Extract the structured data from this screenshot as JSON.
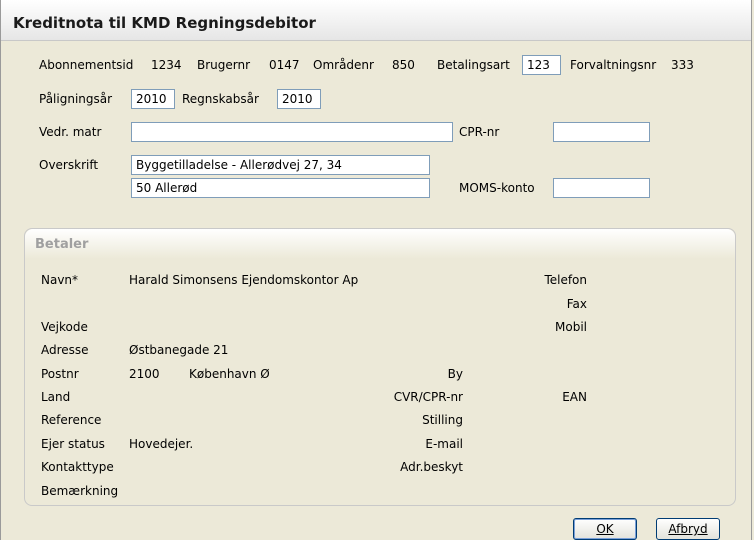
{
  "window": {
    "title": "Kreditnota til KMD Regningsdebitor"
  },
  "header": {
    "abonnementsid_label": "Abonnementsid",
    "abonnementsid_value": "1234",
    "brugernr_label": "Brugernr",
    "brugernr_value": "0147",
    "omraadenr_label": "Områdenr",
    "omraadenr_value": "850",
    "betalingsart_label": "Betalingsart",
    "betalingsart_value": "123",
    "forvaltningsnr_label": "Forvaltningsnr",
    "forvaltningsnr_value": "333",
    "paaligningsaar_label": "Påligningsår",
    "paaligningsaar_value": "2010",
    "regnskabsaar_label": "Regnskabsår",
    "regnskabsaar_value": "2010",
    "vedr_matr_label": "Vedr. matr",
    "vedr_matr_value": "",
    "cpr_label": "CPR-nr",
    "cpr_value": "",
    "overskrift_label": "Overskrift",
    "overskrift_line1": "Byggetilladelse - Allerødvej 27, 34",
    "overskrift_line2": "50  Allerød",
    "moms_label": "MOMS-konto",
    "moms_value": ""
  },
  "betaler": {
    "title": "Betaler",
    "navn_label": "Navn*",
    "navn_value": "Harald Simonsens Ejendomskontor Ap",
    "vejkode_label": "Vejkode",
    "adresse_label": "Adresse",
    "adresse_value": "Østbanegade 21",
    "postnr_label": "Postnr",
    "postnr_value": "2100",
    "city_value": "København Ø",
    "land_label": "Land",
    "reference_label": "Reference",
    "ejer_status_label": "Ejer status",
    "ejer_status_value": "Hovedejer.",
    "kontakttype_label": "Kontakttype",
    "bemaerkning_label": "Bemærkning",
    "telefon_label": "Telefon",
    "fax_label": "Fax",
    "mobil_label": "Mobil",
    "by_label": "By",
    "cvr_label": "CVR/CPR-nr",
    "ean_label": "EAN",
    "stilling_label": "Stilling",
    "email_label": "E-mail",
    "adr_beskyt_label": "Adr.beskyt"
  },
  "buttons": {
    "ok": "OK",
    "cancel": "Afbryd"
  }
}
